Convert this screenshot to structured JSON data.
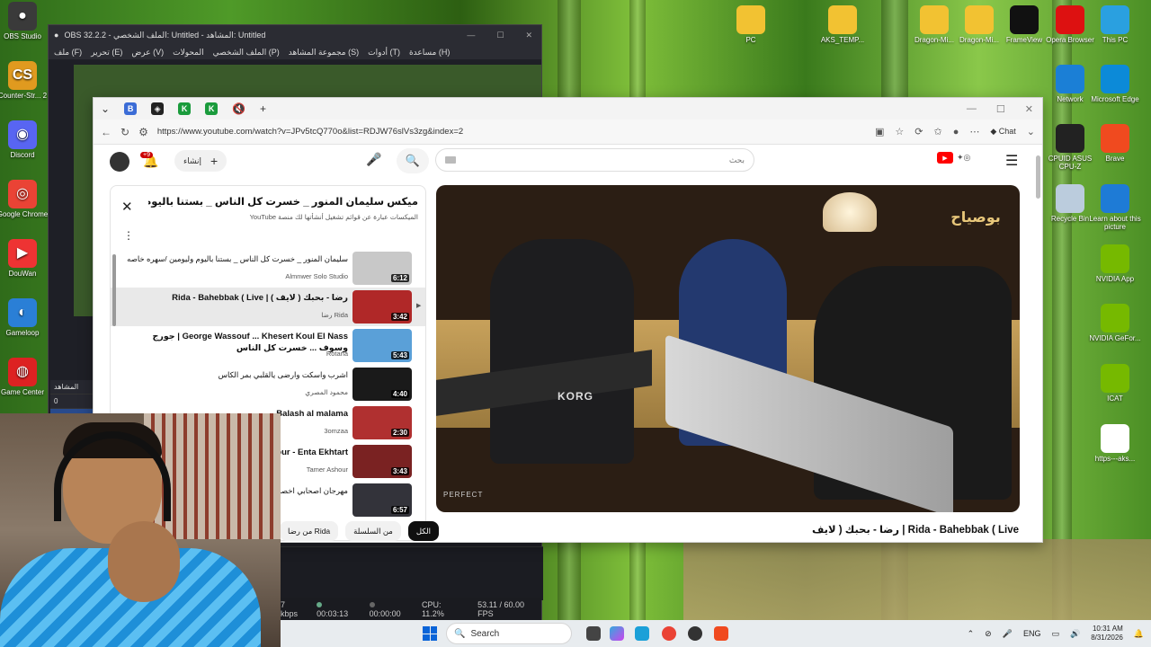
{
  "desktop_left": [
    {
      "label": "OBS Studio",
      "color": "#3a3a3a",
      "glyph": "●"
    },
    {
      "label": "Counter-Str... 2",
      "color": "#e09a1f",
      "glyph": "CS"
    },
    {
      "label": "Discord",
      "color": "#5865f2",
      "glyph": "◉"
    },
    {
      "label": "Google Chrome",
      "color": "#ea4335",
      "glyph": "◎"
    },
    {
      "label": "DouWan",
      "color": "#e33",
      "glyph": "▶"
    },
    {
      "label": "Gameloop",
      "color": "#2a7fd6",
      "glyph": "◐"
    },
    {
      "label": "Game Center",
      "color": "#d22",
      "glyph": "◍"
    }
  ],
  "desktop_top": [
    {
      "label": "PC",
      "color": "#f2c232"
    },
    {
      "label": "AKS_TEMP...",
      "color": "#f2c232"
    },
    {
      "label": "Dragon-Mi...",
      "color": "#f2c232"
    },
    {
      "label": "Dragon-Mi...",
      "color": "#f2c232"
    },
    {
      "label": "FrameView",
      "color": "#111"
    },
    {
      "label": "Opera Browser",
      "color": "#d11"
    },
    {
      "label": "This PC",
      "color": "#2aa0e0"
    }
  ],
  "desktop_right": [
    {
      "label": "Network",
      "color": "#1b7fd6"
    },
    {
      "label": "Microsoft Edge",
      "color": "#0c8ad8"
    },
    {
      "label": "CPUID ASUS CPU-Z",
      "color": "#222"
    },
    {
      "label": "Brave",
      "color": "#f04a1f"
    },
    {
      "label": "Recycle Bin",
      "color": "#bcd"
    },
    {
      "label": "Learn about this picture",
      "color": "#1e7bd6"
    },
    {
      "label": "NVIDIA App",
      "color": "#76b900"
    },
    {
      "label": "NVIDIA GeFor...",
      "color": "#76b900"
    },
    {
      "label": "ICAT",
      "color": "#76b900"
    },
    {
      "label": "https---aks...",
      "color": "#fff"
    }
  ],
  "obs": {
    "title": "OBS 32.2.2 - الملف الشخصي: Untitled - المشاهد: Untitled",
    "menu": [
      "ملف (F)",
      "تحرير (E)",
      "عرض (V)",
      "المحولات",
      "الملف الشخصي (P)",
      "مجموعة المشاهد (S)",
      "أدوات (T)",
      "مساعدة (H)"
    ],
    "scenes_header": "المشاهد",
    "scene_value": "0",
    "scene_selected": "بث",
    "status": {
      "bitrate": "7 kbps",
      "time1": "00:03:13",
      "time2": "00:00:00",
      "cpu": "CPU: 11.2%",
      "fps": "53.11 / 60.00 FPS"
    }
  },
  "browser": {
    "url": "https://www.youtube.com/watch?v=JPv5tcQ770o&list=RDJW76slVs3zg&index=2",
    "chat_label": "Chat"
  },
  "youtube": {
    "create_label": "إنشاء",
    "notif_count": "+9",
    "search_placeholder": "بحث",
    "playlist_title": "ميكس سليمان المنور _ خسرت كل الناس _ بستنا باليوم وليومين /س...",
    "playlist_sub": "الميكسات عبارة عن قوائم تشغيل أنشأتها لك منصة YouTube",
    "items": [
      {
        "title": "سليمان المنور _ خسرت كل الناس _ بستنا باليوم وليومين /سهره خاصه",
        "channel": "Almnwer Solo Studio",
        "duration": "6:12",
        "thumb": "#c8c8c8"
      },
      {
        "title": "رضا - بحبك ( لايف ) | Rida - Bahebbak ( Live",
        "channel": "رضا Rida",
        "duration": "3:42",
        "thumb": "#b02828"
      },
      {
        "title": "George Wassouf ... Khesert Koul El Nass | جورج وسوف ... خسرت كل الناس",
        "channel": "Rotana",
        "duration": "5:43",
        "thumb": "#5aa0d8"
      },
      {
        "title": "اشرب واسكت وارضى يالقلبي بمر الكاس",
        "channel": "محمود المصري",
        "duration": "4:40",
        "thumb": "#1a1a1a"
      },
      {
        "title": "Balash al malama",
        "channel": "3omzaa",
        "duration": "2:30",
        "thumb": "#b03030"
      },
      {
        "title": "Tamer Ashour - Enta Ekhtart",
        "channel": "Tamer Ashour",
        "duration": "3:43",
        "thumb": "#7a2222"
      },
      {
        "title": "مهرجان اصحابي اخصام امين خيطا الاراتاني | زيزو",
        "channel": "",
        "duration": "6:57",
        "thumb": "#33333a"
      }
    ],
    "chips": [
      "الكل",
      "من السلسلة",
      "من رضا Rida"
    ],
    "video_title": "رضا - بحبك ( لايف | Rida - Bahebbak ( Live",
    "player_logo": "بوصياح",
    "watermark": "PERFECT",
    "keyboard_brand": "KORG"
  },
  "taskbar": {
    "search_label": "Search",
    "lang": "ENG",
    "time": "10:31 AM",
    "date": "8/31/2026"
  }
}
